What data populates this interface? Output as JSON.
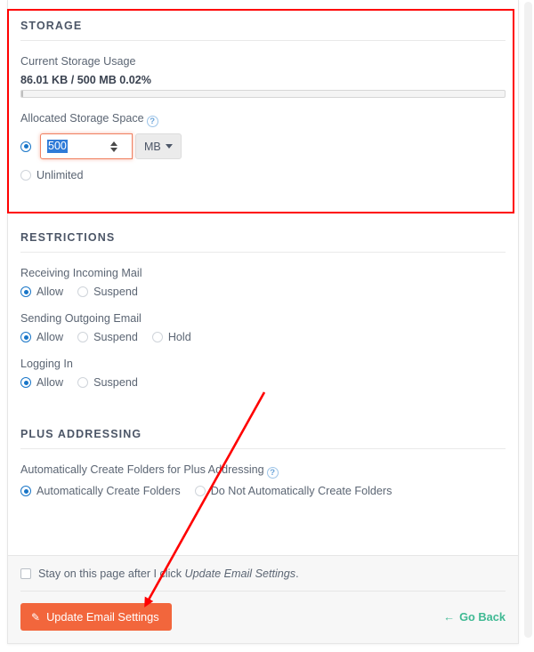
{
  "storage": {
    "heading": "STORAGE",
    "current_usage_label": "Current Storage Usage",
    "usage_text": "86.01 KB / 500 MB 0.02%",
    "usage_percent": 0.02,
    "allocated_label": "Allocated Storage Space",
    "help_icon": "help-circle-icon",
    "quota_value": "500",
    "unit_value": "MB",
    "unlimited_label": "Unlimited",
    "quota_selected": true,
    "unlimited_selected": false
  },
  "restrictions": {
    "heading": "RESTRICTIONS",
    "groups": [
      {
        "label": "Receiving Incoming Mail",
        "options": [
          {
            "label": "Allow",
            "selected": true
          },
          {
            "label": "Suspend",
            "selected": false
          }
        ]
      },
      {
        "label": "Sending Outgoing Email",
        "options": [
          {
            "label": "Allow",
            "selected": true
          },
          {
            "label": "Suspend",
            "selected": false
          },
          {
            "label": "Hold",
            "selected": false
          }
        ]
      },
      {
        "label": "Logging In",
        "options": [
          {
            "label": "Allow",
            "selected": true
          },
          {
            "label": "Suspend",
            "selected": false
          }
        ]
      }
    ]
  },
  "plus_addressing": {
    "heading": "PLUS ADDRESSING",
    "label": "Automatically Create Folders for Plus Addressing",
    "help_icon": "help-circle-icon",
    "options": [
      {
        "label": "Automatically Create Folders",
        "selected": true
      },
      {
        "label": "Do Not Automatically Create Folders",
        "selected": false
      }
    ]
  },
  "footer": {
    "stay_checkbox_checked": false,
    "stay_text_before": "Stay on this page after I click ",
    "stay_text_emphasis": "Update Email Settings",
    "stay_text_after": ".",
    "submit_label": "Update Email Settings",
    "submit_icon": "pencil-icon",
    "go_back_label": "Go Back",
    "go_back_icon": "arrow-left-icon"
  },
  "colors": {
    "primary_button": "#f2663c",
    "link_green": "#3fb993",
    "radio_blue": "#1976c8",
    "annotation_red": "#ff0000",
    "focus_orange": "#f08060",
    "selection_blue": "#2f7bd8"
  }
}
